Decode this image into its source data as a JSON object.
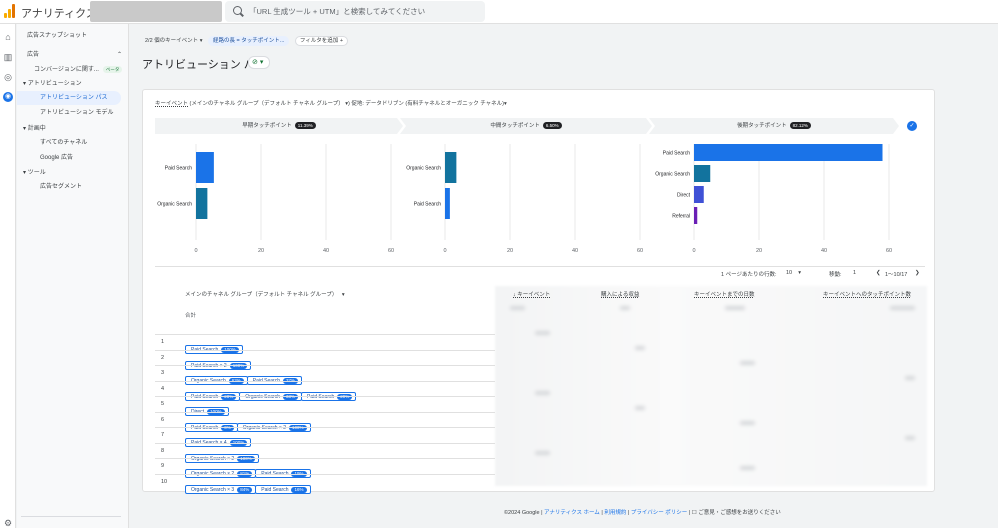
{
  "app": {
    "title": "アナリティクス"
  },
  "search": {
    "placeholder": "「URL 生成ツール + UTM」と検索してみてください"
  },
  "rail_icons": [
    "home-icon",
    "reports-icon",
    "explore-icon",
    "advertising-icon",
    "settings-icon"
  ],
  "sidenav": {
    "snapshot": "広告スナップショット",
    "section_ads": "広告",
    "conversion": "コンバージョンに関す...",
    "conversion_badge": "ベータ",
    "attribution": "アトリビューション",
    "attribution_paths": "アトリビューション パス",
    "attribution_model": "アトリビューション モデル",
    "performance": "計画中",
    "all_channels": "すべてのチャネル",
    "google_ads": "Google 広告",
    "tools": "ツール",
    "ad_segments": "広告セグメント"
  },
  "filters": {
    "key_events": "2/2 個のキーイベント",
    "chip1": "経路の長 = タッチポイント...",
    "add_filter": "フィルタを追加"
  },
  "page": {
    "title": "アトリビューション パス",
    "badge": "⊘"
  },
  "card": {
    "subtitle_link": "キーイベント",
    "subtitle_rest": "(メインのチャネル グループ（デフォルト チャネル グループ） ▾) 促地: データドリブン (有料チャネルとオーガニック チャネル)▾",
    "stages": [
      {
        "label": "早期タッチポイント",
        "pct": "11.39%"
      },
      {
        "label": "中間タッチポイント",
        "pct": "6.50%"
      },
      {
        "label": "後期タッチポイント",
        "pct": "82.12%"
      }
    ]
  },
  "chart_data": [
    {
      "type": "bar",
      "title": "早期タッチポイント",
      "categories": [
        "Paid Search",
        "Organic Search"
      ],
      "values": [
        5.5,
        3.5
      ],
      "xlim": [
        0,
        60
      ],
      "ticks": [
        0,
        20,
        40,
        60
      ],
      "colors": [
        "#1a73e8",
        "#12739e"
      ]
    },
    {
      "type": "bar",
      "title": "中間タッチポイント",
      "categories": [
        "Organic Search",
        "Paid Search"
      ],
      "values": [
        3.5,
        1.5
      ],
      "xlim": [
        0,
        60
      ],
      "ticks": [
        0,
        20,
        40,
        60
      ],
      "colors": [
        "#12739e",
        "#1a73e8"
      ]
    },
    {
      "type": "bar",
      "title": "後期タッチポイント",
      "categories": [
        "Paid Search",
        "Organic Search",
        "Direct",
        "Referral"
      ],
      "values": [
        58,
        5,
        3,
        1
      ],
      "xlim": [
        0,
        60
      ],
      "ticks": [
        0,
        20,
        40,
        60
      ],
      "colors": [
        "#1a73e8",
        "#12739e",
        "#3f51d6",
        "#6a1fb5"
      ]
    }
  ],
  "pager": {
    "rows_label": "1 ページあたりの行数:",
    "rows_value": "10",
    "goto_label": "移動:",
    "goto_value": "1",
    "range": "1～10/17"
  },
  "table": {
    "col_dimension": "メインのチャネル グループ（デフォルト チャネル グループ）",
    "col_key_events": "キーイベント",
    "col_revenue": "購入による収益",
    "col_days": "キーイベントまでの日数",
    "col_touchpoints": "キーイベントへのタッチポイント数",
    "total_label": "合計",
    "rows": [
      {
        "n": "1",
        "steps": [
          {
            "label": "Paid Search",
            "b": "100%"
          }
        ]
      },
      {
        "n": "2",
        "steps": [
          {
            "label": "Paid Search × 2",
            "b": "100%"
          }
        ]
      },
      {
        "n": "3",
        "steps": [
          {
            "label": "Organic Search",
            "b": "63%"
          },
          {
            "label": "Paid Search",
            "b": "37%"
          }
        ]
      },
      {
        "n": "4",
        "steps": [
          {
            "label": "Paid Search",
            "b": "28%"
          },
          {
            "label": "Organic Search",
            "b": "33%"
          },
          {
            "label": "Paid Search",
            "b": "29%"
          }
        ]
      },
      {
        "n": "5",
        "steps": [
          {
            "label": "Direct",
            "b": "100%"
          }
        ]
      },
      {
        "n": "6",
        "steps": [
          {
            "label": "Paid Search",
            "b": "0%"
          },
          {
            "label": "Organic Search × 2",
            "b": "100%"
          }
        ]
      },
      {
        "n": "7",
        "steps": [
          {
            "label": "Paid Search × 4",
            "b": "100%"
          }
        ]
      },
      {
        "n": "8",
        "steps": [
          {
            "label": "Organic Search × 2",
            "b": "100%"
          }
        ]
      },
      {
        "n": "9",
        "steps": [
          {
            "label": "Organic Search × 2",
            "b": "81%"
          },
          {
            "label": "Paid Search",
            "b": "19%"
          }
        ]
      },
      {
        "n": "10",
        "steps": [
          {
            "label": "Organic Search × 3",
            "b": "84%"
          },
          {
            "label": "Paid Search",
            "b": "16%"
          }
        ]
      }
    ]
  },
  "footer": {
    "copyright": "©2024 Google |",
    "home": "アナリティクス ホーム",
    "sep1": "|",
    "terms": "利用規約",
    "sep2": "|",
    "privacy": "プライバシー ポリシー",
    "sep3": "|",
    "feedback": "☐ ご意見・ご感想をお送りください"
  }
}
